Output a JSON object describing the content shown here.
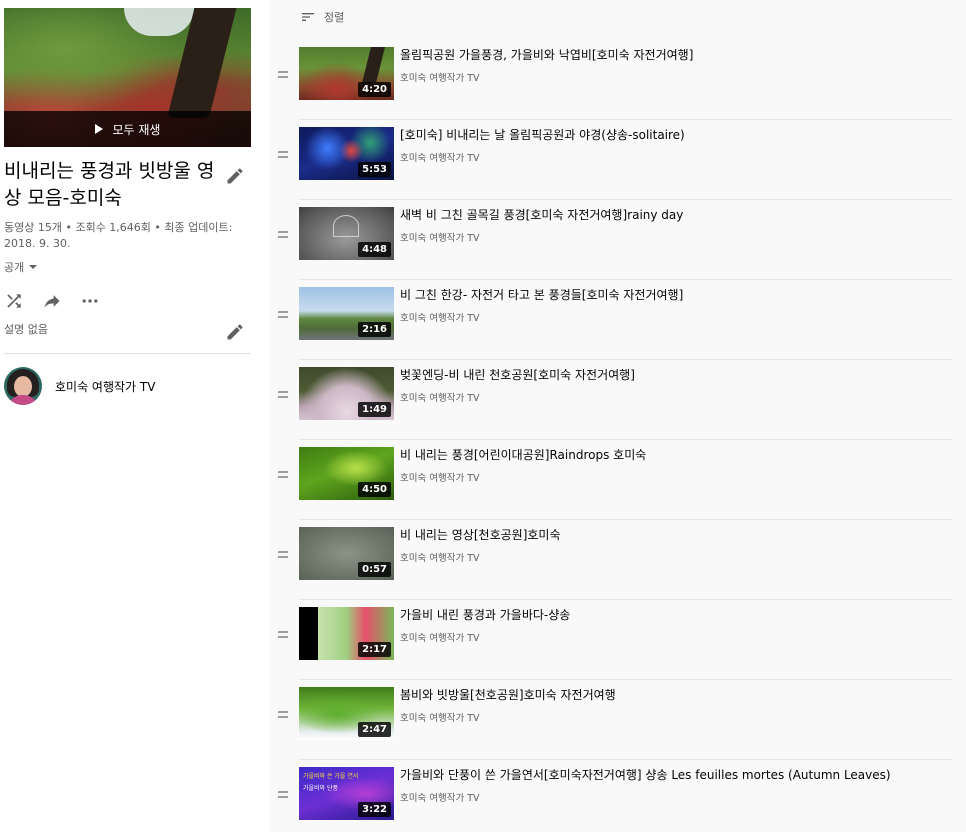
{
  "playlist": {
    "play_all_label": "모두 재생",
    "title": "비내리는 풍경과 빗방울 영상 모음-호미숙",
    "meta": "동영상 15개 • 조회수 1,646회 • 최종 업데이트: 2018. 9. 30.",
    "privacy": "공개",
    "description": "설명 없음",
    "owner": "호미숙 여행작가 TV"
  },
  "sort": {
    "label": "정렬"
  },
  "videos": [
    {
      "title": "올림픽공원 가을풍경, 가을비와 낙엽비[호미숙 자전거여행]",
      "channel": "호미숙 여행작가 TV",
      "duration": "4:20"
    },
    {
      "title": "[호미숙] 비내리는 날 올림픽공원과 야경(샹송-solitaire)",
      "channel": "호미숙 여행작가 TV",
      "duration": "5:53"
    },
    {
      "title": "새벽 비 그친 골목길 풍경[호미숙 자전거여행]rainy day",
      "channel": "호미숙 여행작가 TV",
      "duration": "4:48"
    },
    {
      "title": "비 그친 한강- 자전거 타고 본 풍경들[호미숙 자전거여행]",
      "channel": "호미숙 여행작가 TV",
      "duration": "2:16"
    },
    {
      "title": "벚꽃엔딩-비 내린 천호공원[호미숙 자전거여행]",
      "channel": "호미숙 여행작가 TV",
      "duration": "1:49"
    },
    {
      "title": "비 내리는 풍경[어린이대공원]Raindrops 호미숙",
      "channel": "호미숙 여행작가 TV",
      "duration": "4:50"
    },
    {
      "title": "비 내리는 영상[천호공원]호미숙",
      "channel": "호미숙 여행작가 TV",
      "duration": "0:57"
    },
    {
      "title": "가을비 내린 풍경과 가을바다-샹송",
      "channel": "호미숙 여행작가 TV",
      "duration": "2:17"
    },
    {
      "title": "봄비와 빗방울[천호공원]호미숙 자전거여행",
      "channel": "호미숙 여행작가 TV",
      "duration": "2:47"
    },
    {
      "title": "가을비와 단풍이 쓴 가을연서[호미숙자전거여행] 샹송 Les feuilles mortes (Autumn Leaves)",
      "channel": "호미숙 여행작가 TV",
      "duration": "3:22",
      "thumb_text_1": "가을비와 쓴 가을 연서",
      "thumb_text_2": "가을비와 단풍"
    }
  ]
}
